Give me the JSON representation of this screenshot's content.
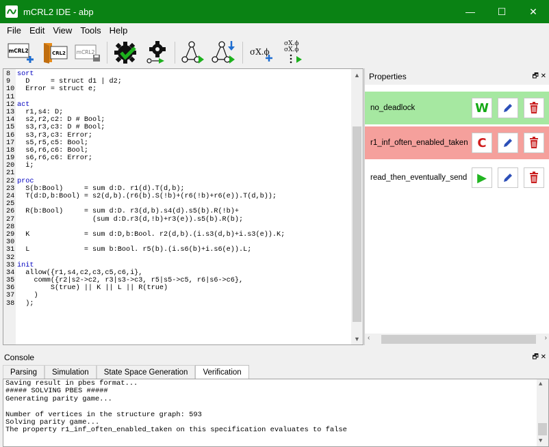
{
  "window": {
    "title": "mCRL2 IDE - abp",
    "minimize": "—",
    "maximize": "☐",
    "close": "✕"
  },
  "menu": [
    "File",
    "Edit",
    "View",
    "Tools",
    "Help"
  ],
  "toolbar": {
    "new_label": "mCRL2",
    "open_label": "CRL2",
    "save_label": "mCRL2"
  },
  "editor": {
    "lines": [
      {
        "n": "8",
        "t": "sort"
      },
      {
        "n": "9",
        "t": "  D     = struct d1 | d2;"
      },
      {
        "n": "10",
        "t": "  Error = struct e;"
      },
      {
        "n": "11",
        "t": ""
      },
      {
        "n": "12",
        "t": "act"
      },
      {
        "n": "13",
        "t": "  r1,s4: D;"
      },
      {
        "n": "14",
        "t": "  s2,r2,c2: D # Bool;"
      },
      {
        "n": "15",
        "t": "  s3,r3,c3: D # Bool;"
      },
      {
        "n": "16",
        "t": "  s3,r3,c3: Error;"
      },
      {
        "n": "17",
        "t": "  s5,r5,c5: Bool;"
      },
      {
        "n": "18",
        "t": "  s6,r6,c6: Bool;"
      },
      {
        "n": "19",
        "t": "  s6,r6,c6: Error;"
      },
      {
        "n": "20",
        "t": "  i;"
      },
      {
        "n": "21",
        "t": ""
      },
      {
        "n": "22",
        "t": "proc"
      },
      {
        "n": "23",
        "t": "  S(b:Bool)     = sum d:D. r1(d).T(d,b);"
      },
      {
        "n": "24",
        "t": "  T(d:D,b:Bool) = s2(d,b).(r6(b).S(!b)+(r6(!b)+r6(e)).T(d,b));"
      },
      {
        "n": "25",
        "t": ""
      },
      {
        "n": "26",
        "t": "  R(b:Bool)     = sum d:D. r3(d,b).s4(d).s5(b).R(!b)+"
      },
      {
        "n": "27",
        "t": "                  (sum d:D.r3(d,!b)+r3(e)).s5(b).R(b);"
      },
      {
        "n": "28",
        "t": ""
      },
      {
        "n": "29",
        "t": "  K             = sum d:D,b:Bool. r2(d,b).(i.s3(d,b)+i.s3(e)).K;"
      },
      {
        "n": "30",
        "t": ""
      },
      {
        "n": "31",
        "t": "  L             = sum b:Bool. r5(b).(i.s6(b)+i.s6(e)).L;"
      },
      {
        "n": "32",
        "t": ""
      },
      {
        "n": "33",
        "t": "init"
      },
      {
        "n": "34",
        "t": "  allow({r1,s4,c2,c3,c5,c6,i},"
      },
      {
        "n": "35",
        "t": "    comm({r2|s2->c2, r3|s3->c3, r5|s5->c5, r6|s6->c6},"
      },
      {
        "n": "36",
        "t": "        S(true) || K || L || R(true)"
      },
      {
        "n": "37",
        "t": "    )"
      },
      {
        "n": "38",
        "t": "  );"
      }
    ]
  },
  "properties": {
    "title": "Properties",
    "items": [
      {
        "name": "no_deadlock",
        "status": "W",
        "bg": "#a6e8a1",
        "status_color": "#15a915"
      },
      {
        "name": "r1_inf_often_enabled_taken",
        "status": "C",
        "bg": "#f5a09c",
        "status_color": "#d01c1c"
      },
      {
        "name": "read_then_eventually_send",
        "status": "▶",
        "bg": "#ffffff",
        "status_color": "#21b521"
      }
    ],
    "edit_color": "#2c4fb8",
    "delete_color": "#c92020"
  },
  "console": {
    "title": "Console",
    "tabs": [
      "Parsing",
      "Simulation",
      "State Space Generation",
      "Verification"
    ],
    "active_tab": 3,
    "lines": [
      "Saving result in pbes format...",
      "##### SOLVING PBES #####",
      "Generating parity game...",
      "",
      "Number of vertices in the structure graph: 593",
      "Solving parity game...",
      "The property r1_inf_often_enabled_taken on this specification evaluates to false"
    ]
  }
}
